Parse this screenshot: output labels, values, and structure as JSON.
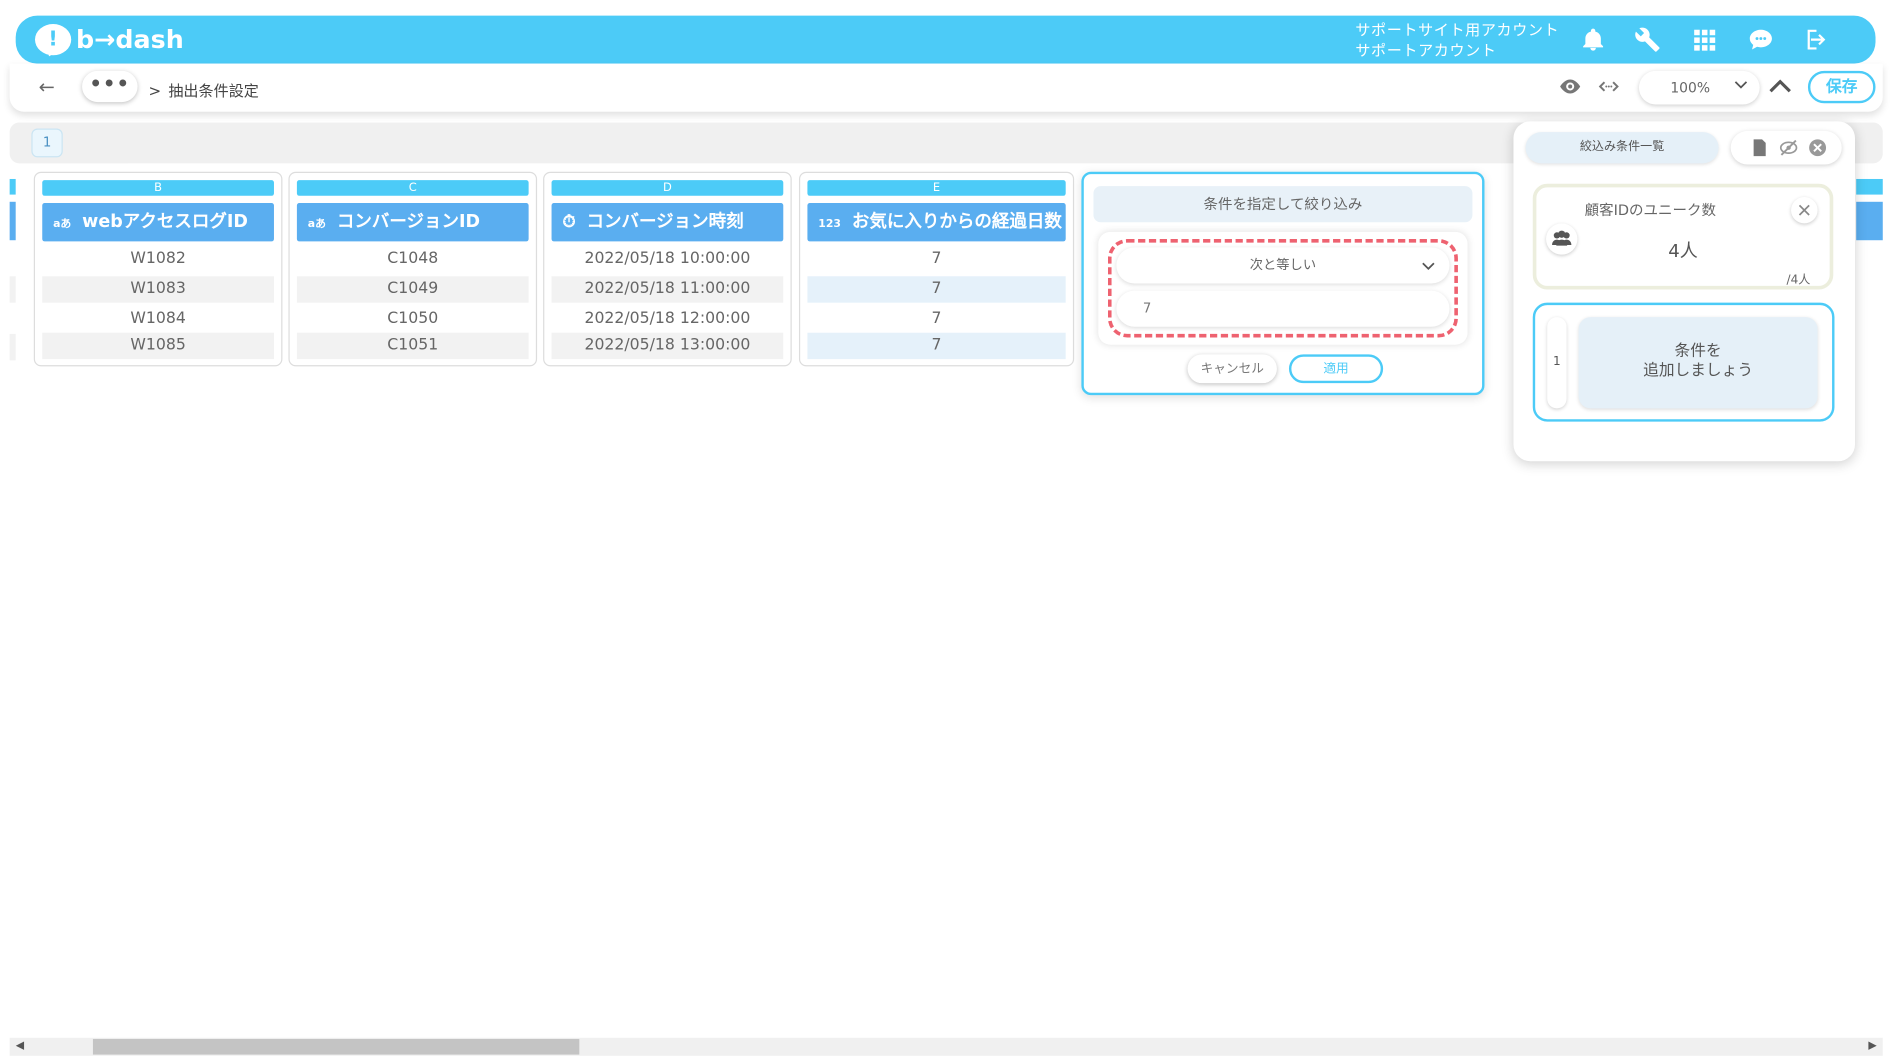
{
  "app": {
    "logo_mark": "!",
    "logo_text": "b→dash",
    "account_line1": "サポートサイト用アカウント",
    "account_line2": "サポートアカウント",
    "header_icons": [
      "bell-icon",
      "wrench-icon",
      "grid-icon",
      "chat-icon",
      "logout-icon"
    ],
    "accent_color": "#4ccbf7"
  },
  "nav": {
    "back": "←",
    "more": "•••",
    "separator": ">",
    "breadcrumb": "抽出条件設定",
    "zoom": "100%",
    "save_label": "保存"
  },
  "pages": {
    "current": "1"
  },
  "columns": [
    {
      "letter": "B",
      "type_icon": "aあ",
      "title": "webアクセスログID",
      "rows": [
        "W1082",
        "W1083",
        "W1084",
        "W1085"
      ]
    },
    {
      "letter": "C",
      "type_icon": "aあ",
      "title": "コンバージョンID",
      "rows": [
        "C1048",
        "C1049",
        "C1050",
        "C1051"
      ]
    },
    {
      "letter": "D",
      "type_icon": "⏱",
      "title": "コンバージョン時刻",
      "rows": [
        "2022/05/18 10:00:00",
        "2022/05/18 11:00:00",
        "2022/05/18 12:00:00",
        "2022/05/18 13:00:00"
      ]
    },
    {
      "letter": "E",
      "type_icon": "123",
      "title": "お気に入りからの経過日数",
      "rows": [
        "7",
        "7",
        "7",
        "7"
      ]
    }
  ],
  "filter_popup": {
    "title": "条件を指定して絞り込み",
    "operator": "次と等しい",
    "value": "7",
    "cancel_label": "キャンセル",
    "apply_label": "適用"
  },
  "right_panel": {
    "tab_label": "絞込み条件一覧",
    "metric_label": "顧客IDのユニーク数",
    "metric_value": "4人",
    "metric_total": "/4人",
    "condition_number": "1",
    "add_condition_line1": "条件を",
    "add_condition_line2": "追加しましょう"
  }
}
